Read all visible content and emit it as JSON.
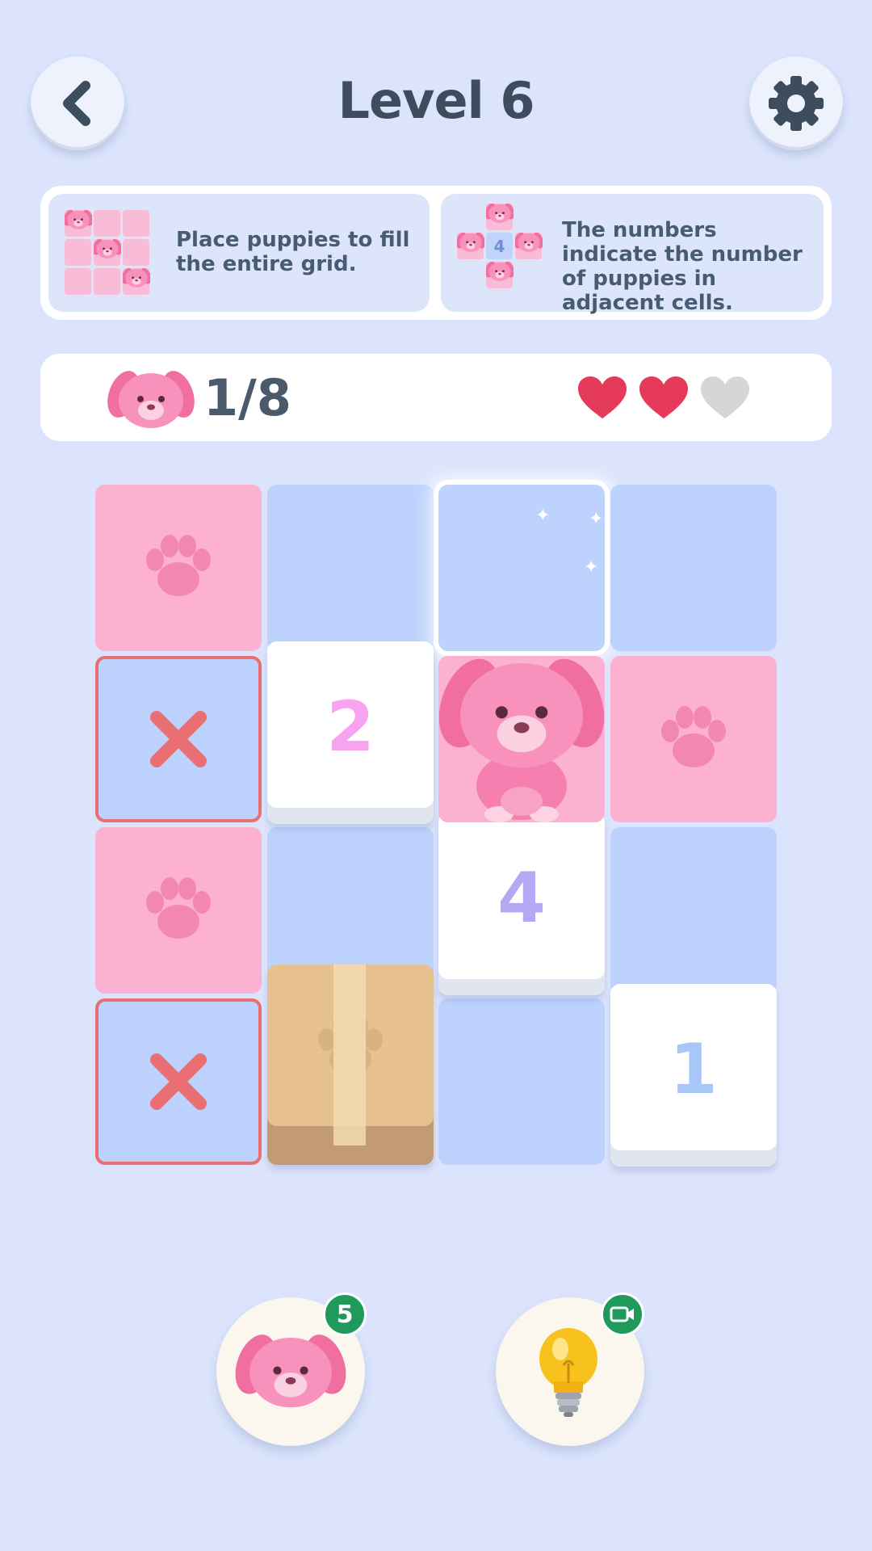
{
  "header": {
    "title": "Level 6",
    "back_icon": "chevron-left-icon",
    "settings_icon": "gear-icon"
  },
  "instructions": [
    {
      "text": "Place puppies to fill the entire grid."
    },
    {
      "text": "The numbers indicate the number of puppies in adjacent cells.",
      "example_number": "4"
    }
  ],
  "status": {
    "puppies_placed": "1/8",
    "lives_total": 3,
    "lives_remaining": 2
  },
  "grid": {
    "rows": 4,
    "cols": 4,
    "cells": [
      [
        "paw",
        "empty",
        "selected",
        "empty"
      ],
      [
        "x",
        "2",
        "puppy",
        "paw"
      ],
      [
        "paw",
        "empty",
        "4",
        "empty"
      ],
      [
        "x",
        "box",
        "empty",
        "1"
      ]
    ],
    "number_colors": {
      "2": "#f7a3ef",
      "4": "#b7a8f3",
      "1": "#a9c6f8"
    }
  },
  "tools": {
    "puppy_count": "5",
    "hint_badge_icon": "video-camera-icon"
  },
  "colors": {
    "background": "#dbe4fc",
    "pink_cell": "#fdb1d0",
    "blue_cell": "#bdd2fc",
    "heart_full": "#e63a5a",
    "heart_empty": "#d6d6d6",
    "badge": "#1f9a5b",
    "x_mark": "#ea6f73"
  }
}
